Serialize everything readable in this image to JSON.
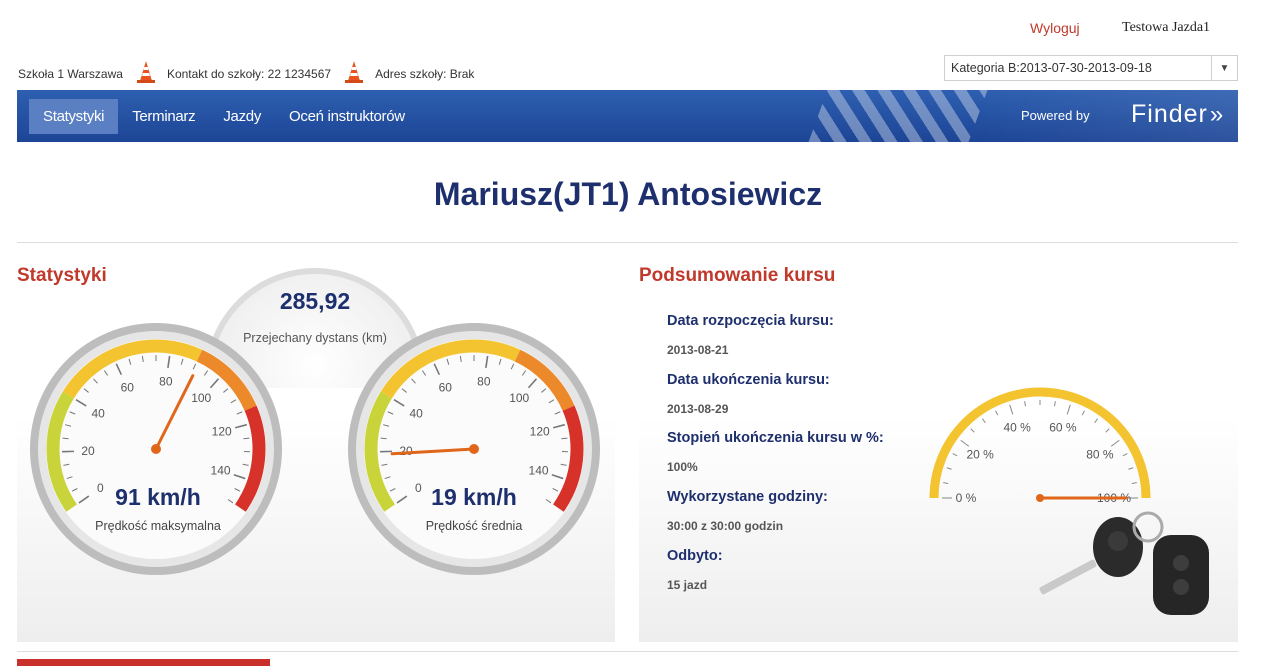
{
  "header": {
    "logout": "Wyloguj",
    "user": "Testowa Jazda1"
  },
  "school": {
    "name": "Szkoła 1 Warszawa",
    "contact": "Kontakt do szkoły: 22 1234567",
    "address": "Adres szkoły: Brak"
  },
  "category": {
    "selected": "Kategoria B:2013-07-30-2013-09-18"
  },
  "nav": {
    "tabs": [
      {
        "label": "Statystyki",
        "active": true
      },
      {
        "label": "Terminarz"
      },
      {
        "label": "Jazdy"
      },
      {
        "label": "Oceń instruktorów"
      }
    ],
    "powered_by": "Powered by",
    "brand": "Finder"
  },
  "page_title": "Mariusz(JT1) Antosiewicz",
  "stats": {
    "title": "Statystyki",
    "distance": {
      "value": "285,92",
      "label": "Przejechany dystans (km)"
    },
    "max_speed": {
      "value": 91,
      "display": "91 km/h",
      "label": "Prędkość maksymalna"
    },
    "avg_speed": {
      "value": 19,
      "display": "19 km/h",
      "label": "Prędkość średnia"
    },
    "speed_ticks": [
      "0",
      "20",
      "40",
      "60",
      "80",
      "100",
      "120",
      "140"
    ]
  },
  "summary": {
    "title": "Podsumowanie kursu",
    "items": [
      {
        "label": "Data rozpoczęcia kursu:",
        "value": "2013-08-21"
      },
      {
        "label": "Data ukończenia kursu:",
        "value": "2013-08-29"
      },
      {
        "label": "Stopień ukończenia kursu w %:",
        "value": "100%"
      },
      {
        "label": "Wykorzystane godziny:",
        "value": "30:00 z 30:00 godzin"
      },
      {
        "label": "Odbyto:",
        "value": "15 jazd"
      }
    ],
    "completion_percent": 100,
    "percent_ticks": [
      "0 %",
      "20 %",
      "40 %",
      "60 %",
      "80 %",
      "100 %"
    ]
  },
  "colors": {
    "nav_blue": "#1d4596",
    "title_blue": "#1e2f6e",
    "accent_red": "#c0392b",
    "needle": "#e0661a"
  }
}
